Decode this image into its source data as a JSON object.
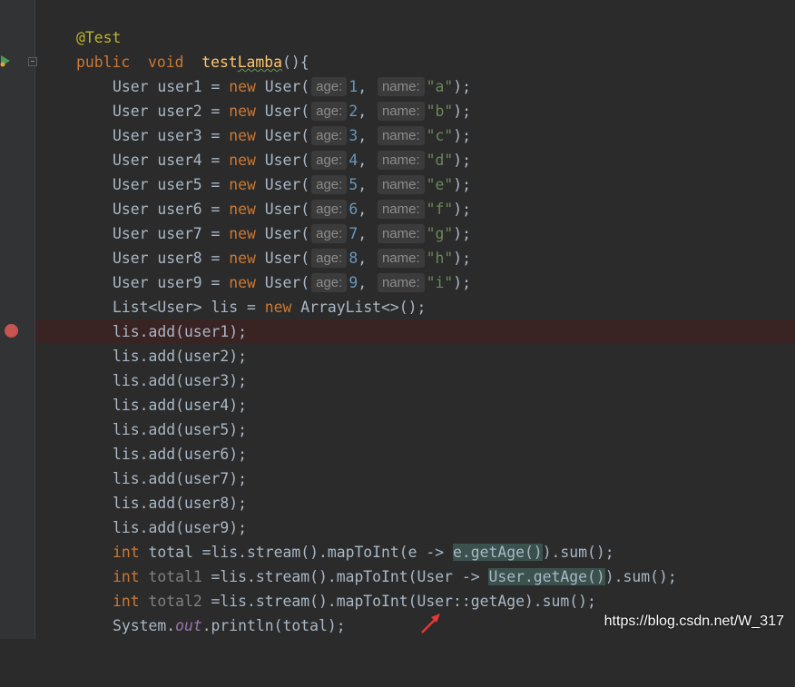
{
  "code": {
    "annotation": "@Test",
    "method": {
      "public": "public",
      "void": "void",
      "name_prefix": "test",
      "name_underlined": "Lamba",
      "sig_tail": "(){"
    },
    "hints": {
      "age": "age:",
      "name": "name:"
    },
    "users": [
      {
        "decl": "User user1 = ",
        "age": "1",
        "name": "\"a\""
      },
      {
        "decl": "User user2 = ",
        "age": "2",
        "name": "\"b\""
      },
      {
        "decl": "User user3 = ",
        "age": "3",
        "name": "\"c\""
      },
      {
        "decl": "User user4 = ",
        "age": "4",
        "name": "\"d\""
      },
      {
        "decl": "User user5 = ",
        "age": "5",
        "name": "\"e\""
      },
      {
        "decl": "User user6 = ",
        "age": "6",
        "name": "\"f\""
      },
      {
        "decl": "User user7 = ",
        "age": "7",
        "name": "\"g\""
      },
      {
        "decl": "User user8 = ",
        "age": "8",
        "name": "\"h\""
      },
      {
        "decl": "User user9 = ",
        "age": "9",
        "name": "\"i\""
      }
    ],
    "list_line": {
      "type": "List<User> lis = ",
      "new_kw": "new",
      "ctor": " ArrayList<>();"
    },
    "adds": [
      "lis.add(user1);",
      "lis.add(user2);",
      "lis.add(user3);",
      "lis.add(user4);",
      "lis.add(user5);",
      "lis.add(user6);",
      "lis.add(user7);",
      "lis.add(user8);",
      "lis.add(user9);"
    ],
    "int_kw": "int",
    "total_line": {
      "pre": " total =lis.stream().mapToInt(e -> ",
      "hl": "e.getAge()",
      "post": ").sum();"
    },
    "total1_line": {
      "var": " total1",
      "pre": " =lis.stream().mapToInt(User -> ",
      "hl": "User.getAge()",
      "post": ").sum();"
    },
    "total2_line": {
      "var": " total2",
      "pre": " =lis.stream().mapToInt(User::getAge).sum();"
    },
    "print_line": {
      "pre": "System.",
      "field": "out",
      "post": ".println(total);"
    },
    "new_kw": "new",
    "user_ctor": "User("
  },
  "watermark": "https://blog.csdn.net/W_317",
  "icons": {
    "breakpoint": "breakpoint-icon",
    "run": "run-test-icon",
    "fold": "fold-icon",
    "arrow": "red-arrow-icon"
  },
  "colors": {
    "background": "#2b2b2b",
    "keyword": "#cc7832",
    "string": "#6a8759",
    "number": "#6897bb",
    "annotation": "#bbb529",
    "method": "#ffc66d",
    "breakpoint": "#c75450"
  }
}
